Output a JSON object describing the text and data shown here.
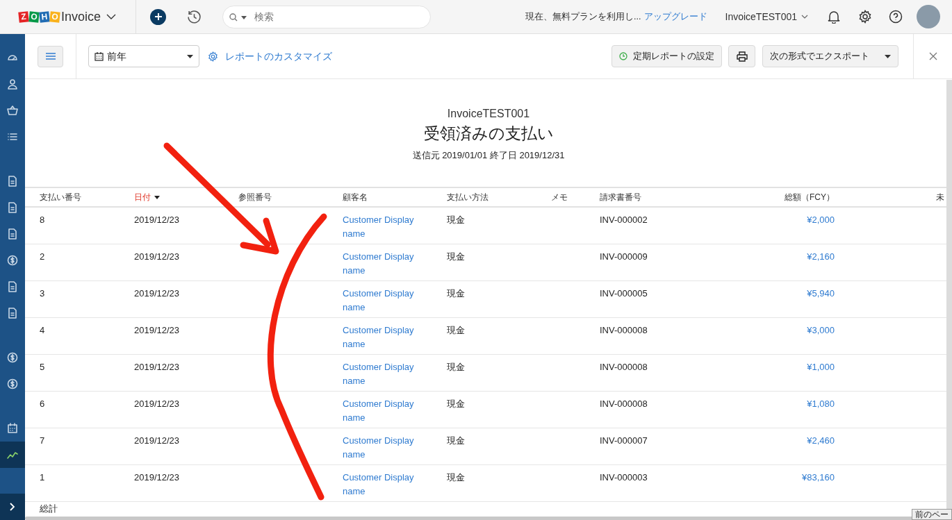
{
  "topbar": {
    "logo_letters": [
      "Z",
      "O",
      "H",
      "O"
    ],
    "app_name": "Invoice",
    "search": {
      "placeholder": "検索"
    },
    "plan_notice": "現在、無料プランを利用し...",
    "upgrade_link": "アップグレード",
    "org_name": "InvoiceTEST001"
  },
  "sidebar": {
    "items": [
      {
        "kind": "dashboard",
        "selected": false
      },
      {
        "kind": "user",
        "selected": false
      },
      {
        "kind": "basket",
        "selected": false
      },
      {
        "kind": "list",
        "selected": false
      },
      {
        "kind": "gap"
      },
      {
        "kind": "doc",
        "selected": false
      },
      {
        "kind": "doc",
        "selected": false
      },
      {
        "kind": "doc",
        "selected": false
      },
      {
        "kind": "coin",
        "selected": false
      },
      {
        "kind": "doc",
        "selected": false
      },
      {
        "kind": "doc",
        "selected": false
      },
      {
        "kind": "gap"
      },
      {
        "kind": "coin",
        "selected": false
      },
      {
        "kind": "coin",
        "selected": false
      },
      {
        "kind": "gap"
      },
      {
        "kind": "calendar",
        "selected": false
      },
      {
        "kind": "chart",
        "selected": true
      }
    ]
  },
  "toolbar": {
    "period": "前年",
    "customize": "レポートのカスタマイズ",
    "schedule": "定期レポートの設定",
    "export": "次の形式でエクスポート"
  },
  "report": {
    "org": "InvoiceTEST001",
    "title": "受領済みの支払い",
    "range": "送信元 2019/01/01 終了日 2019/12/31"
  },
  "table": {
    "columns": [
      {
        "label": "支払い番号",
        "sorted": false
      },
      {
        "label": "日付",
        "sorted": true
      },
      {
        "label": "参照番号",
        "sorted": false
      },
      {
        "label": "顧客名",
        "sorted": false
      },
      {
        "label": "支払い方法",
        "sorted": false
      },
      {
        "label": "メモ",
        "sorted": false
      },
      {
        "label": "請求書番号",
        "sorted": false
      },
      {
        "label": "総額（FCY）",
        "sorted": false
      },
      {
        "label": "未",
        "sorted": false
      }
    ],
    "rows": [
      {
        "no": "8",
        "date": "2019/12/23",
        "customer": "Customer Display name",
        "method": "現金",
        "invoice": "INV-000002",
        "amount": "¥2,000"
      },
      {
        "no": "2",
        "date": "2019/12/23",
        "customer": "Customer Display name",
        "method": "現金",
        "invoice": "INV-000009",
        "amount": "¥2,160"
      },
      {
        "no": "3",
        "date": "2019/12/23",
        "customer": "Customer Display name",
        "method": "現金",
        "invoice": "INV-000005",
        "amount": "¥5,940"
      },
      {
        "no": "4",
        "date": "2019/12/23",
        "customer": "Customer Display name",
        "method": "現金",
        "invoice": "INV-000008",
        "amount": "¥3,000"
      },
      {
        "no": "5",
        "date": "2019/12/23",
        "customer": "Customer Display name",
        "method": "現金",
        "invoice": "INV-000008",
        "amount": "¥1,000"
      },
      {
        "no": "6",
        "date": "2019/12/23",
        "customer": "Customer Display name",
        "method": "現金",
        "invoice": "INV-000008",
        "amount": "¥1,080"
      },
      {
        "no": "7",
        "date": "2019/12/23",
        "customer": "Customer Display name",
        "method": "現金",
        "invoice": "INV-000007",
        "amount": "¥2,460"
      },
      {
        "no": "1",
        "date": "2019/12/23",
        "customer": "Customer Display name",
        "method": "現金",
        "invoice": "INV-000003",
        "amount": "¥83,160"
      }
    ],
    "total_label": "総計"
  },
  "tooltip": "前のペー"
}
